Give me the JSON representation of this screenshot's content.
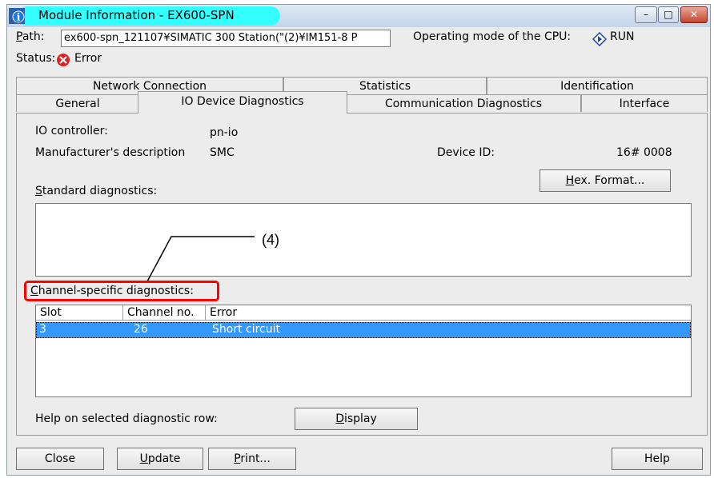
{
  "window": {
    "title": "Module Information - EX600-SPN",
    "controls": {
      "minimize": "–",
      "maximize": "□",
      "close": "✕"
    }
  },
  "path": {
    "label": "Path:",
    "value": "ex600-spn_121107¥SIMATIC 300 Station(\"(2)¥IM151-8 P"
  },
  "cpu_mode": {
    "label": "Operating mode of the  CPU:",
    "value": "RUN"
  },
  "status": {
    "label": "Status:",
    "value": "Error",
    "color": "#e02020"
  },
  "tabs_row1": [
    "Network Connection",
    "Statistics",
    "Identification"
  ],
  "tabs_row2": [
    "General",
    "IO Device Diagnostics",
    "Communication Diagnostics",
    "Interface"
  ],
  "active_tab": "IO Device Diagnostics",
  "io": {
    "controller_label": "IO controller:",
    "controller_value": "pn-io",
    "manufacturer_label": "Manufacturer's description",
    "manufacturer_value": "SMC",
    "device_id_label": "Device ID:",
    "device_id_value": "16# 0008",
    "hex_button": "Hex. Format..."
  },
  "standard_diagnostics": {
    "label": "Standard diagnostics:",
    "content": ""
  },
  "annotation": {
    "label": "(4)",
    "color": "#ff0000"
  },
  "channel_diagnostics": {
    "label": "Channel-specific diagnostics:",
    "columns": [
      "Slot",
      "Channel no.",
      "Error"
    ],
    "rows": [
      {
        "slot": "3",
        "channel": "26",
        "error": "Short circuit"
      }
    ],
    "selection_color": "#3399ff"
  },
  "help_row": {
    "label": "Help on selected diagnostic row:",
    "button": "Display"
  },
  "bottom_buttons": {
    "close": "Close",
    "update": "Update",
    "print": "Print...",
    "help": "Help"
  }
}
